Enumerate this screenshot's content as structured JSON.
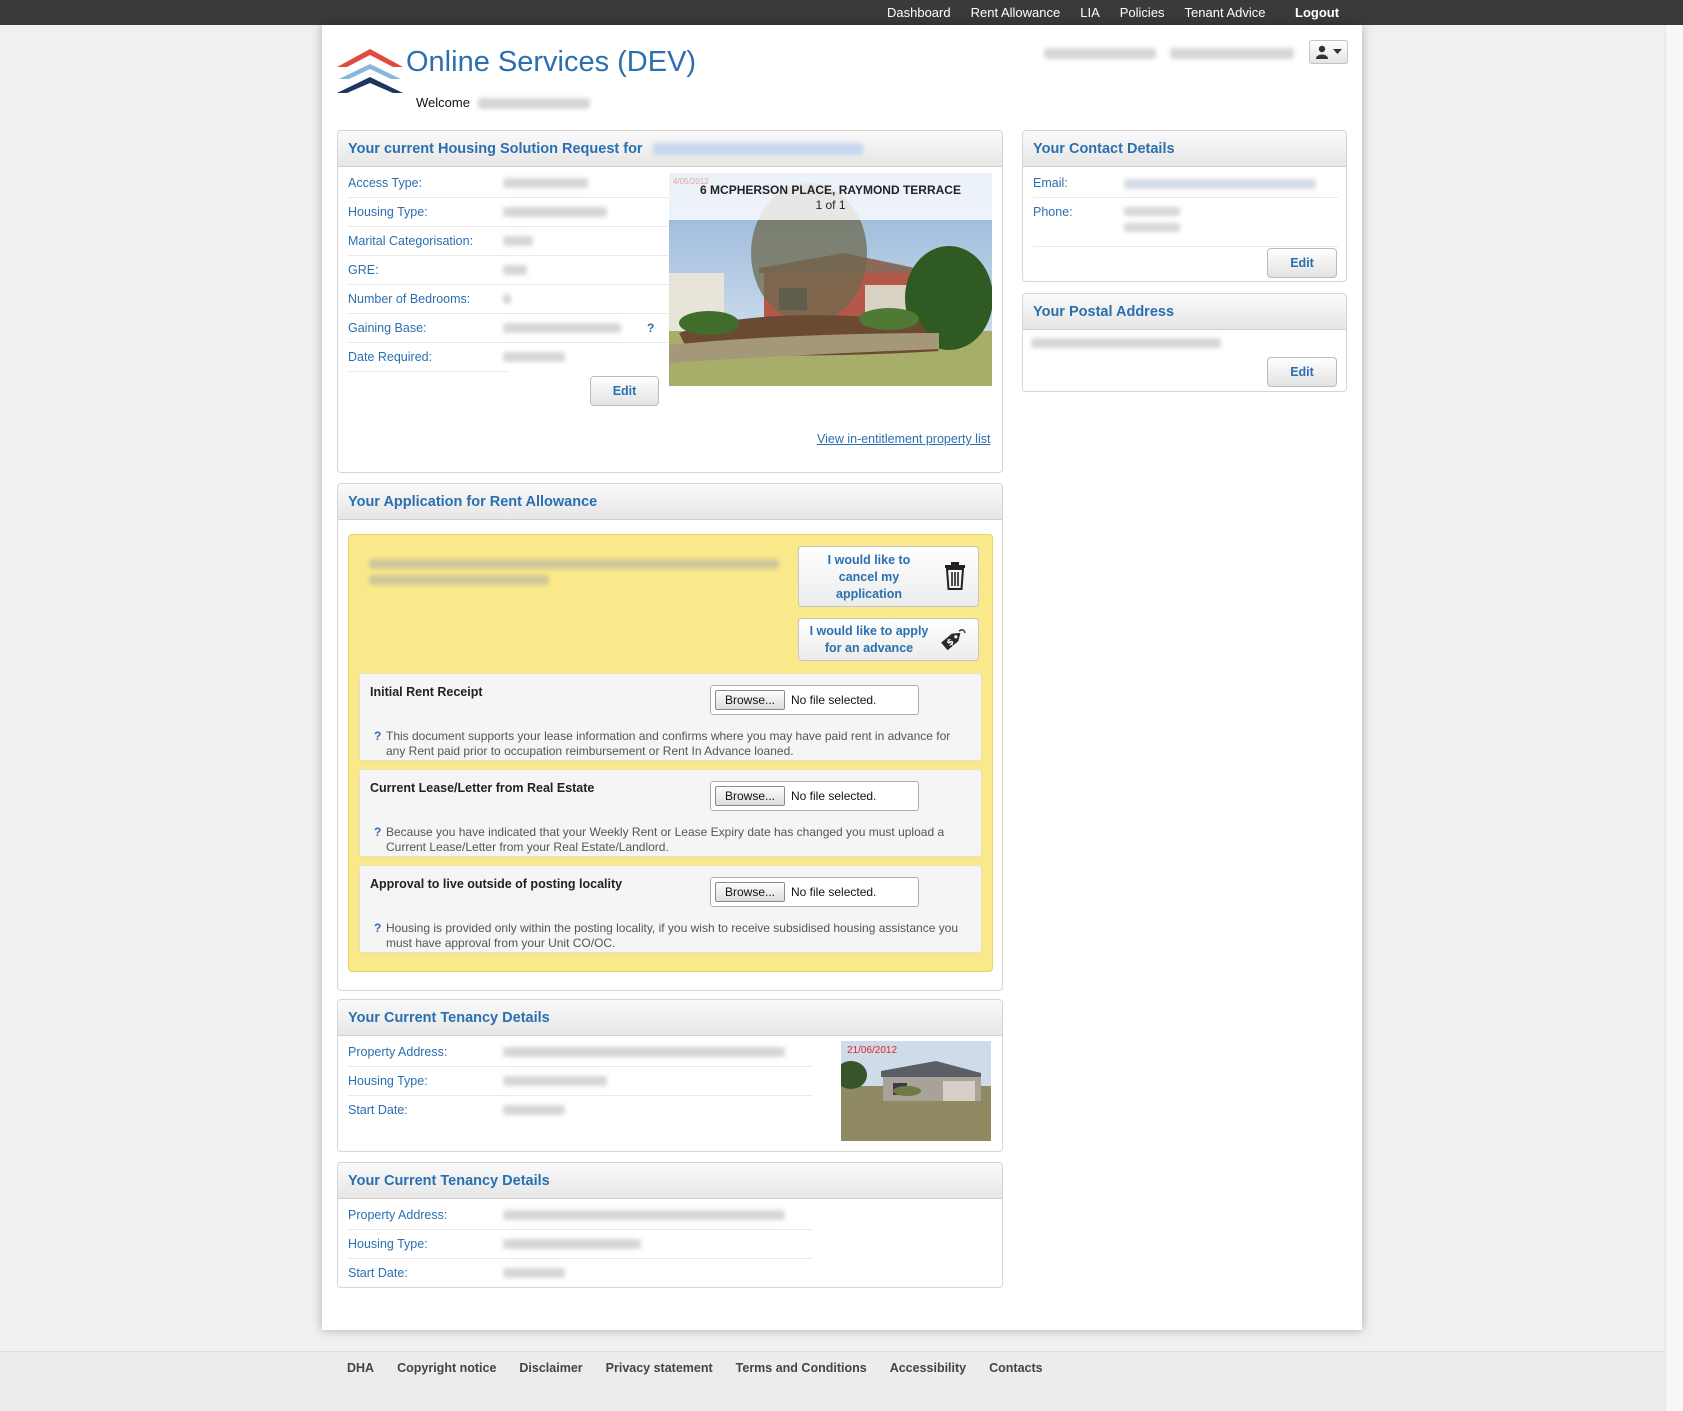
{
  "topnav": {
    "items": [
      "Dashboard",
      "Rent Allowance",
      "LIA",
      "Policies",
      "Tenant Advice"
    ],
    "logout": "Logout"
  },
  "header": {
    "title": "Online Services (DEV)",
    "welcome": "Welcome"
  },
  "housing_request": {
    "title": "Your current Housing Solution Request for",
    "fields": [
      "Access Type:",
      "Housing Type:",
      "Marital Categorisation:",
      "GRE:",
      "Number of Bedrooms:",
      "Gaining Base:",
      "Date Required:"
    ],
    "gaining_base_help": "?",
    "edit": "Edit",
    "photo": {
      "date": "4/05/2012",
      "address": "6 MCPHERSON PLACE, RAYMOND TERRACE",
      "counter": "1 of 1"
    },
    "property_list_link": "View in-entitlement property list"
  },
  "contact": {
    "title": "Your Contact Details",
    "email_label": "Email:",
    "phone_label": "Phone:",
    "edit": "Edit"
  },
  "postal": {
    "title": "Your Postal Address",
    "edit": "Edit"
  },
  "rent_allowance": {
    "title": "Your Application for Rent Allowance",
    "cancel_button": "I would like to cancel my application",
    "advance_button": "I would like to apply for an advance",
    "uploads": [
      {
        "title": "Initial Rent Receipt",
        "browse": "Browse...",
        "file_status": "No file selected.",
        "help": "This document supports your lease information and confirms where you may have paid rent in advance for any Rent paid prior to occupation reimbursement or Rent In Advance loaned."
      },
      {
        "title": "Current Lease/Letter from Real Estate",
        "browse": "Browse...",
        "file_status": "No file selected.",
        "help": "Because you have indicated that your Weekly Rent or Lease Expiry date has changed you must upload a Current Lease/Letter from your Real Estate/Landlord."
      },
      {
        "title": "Approval to live outside of posting locality",
        "browse": "Browse...",
        "file_status": "No file selected.",
        "help": "Housing is provided only within the posting locality, if you wish to receive subsidised housing assistance you must have approval from your Unit CO/OC."
      }
    ],
    "help_mark": "?"
  },
  "tenancy_1": {
    "title": "Your Current Tenancy Details",
    "fields": [
      "Property Address:",
      "Housing Type:",
      "Start Date:"
    ],
    "photo_date": "21/06/2012"
  },
  "tenancy_2": {
    "title": "Your Current Tenancy Details",
    "fields": [
      "Property Address:",
      "Housing Type:",
      "Start Date:"
    ]
  },
  "footer": {
    "links": [
      "DHA",
      "Copyright notice",
      "Disclaimer",
      "Privacy statement",
      "Terms and Conditions",
      "Accessibility",
      "Contacts"
    ]
  },
  "colors": {
    "brand_blue": "#2a6fb0",
    "topbar": "#3a3a3a",
    "highlight_yellow": "#fae98a"
  },
  "icons": [
    "user-icon",
    "caret-down-icon",
    "trash-icon",
    "money-tag-icon",
    "question-icon"
  ]
}
